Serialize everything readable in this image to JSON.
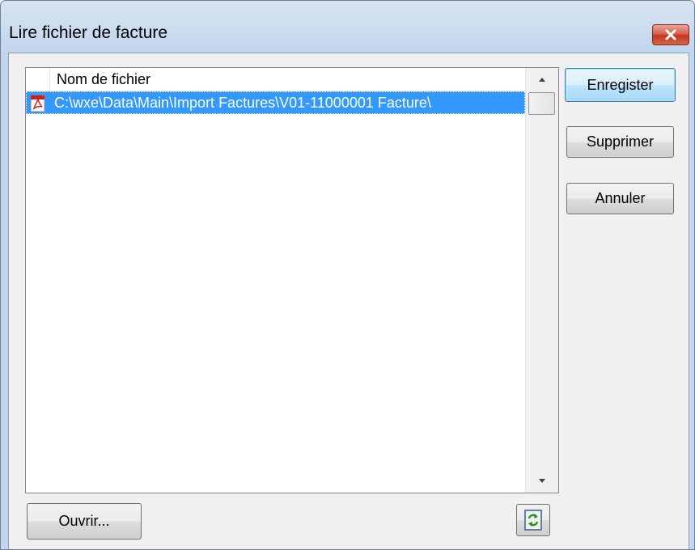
{
  "window": {
    "title": "Lire fichier de facture",
    "close_icon": "close-x-icon"
  },
  "file_list": {
    "column_header": "Nom de fichier",
    "rows": [
      {
        "icon": "pdf-file-icon",
        "path": "C:\\wxe\\Data\\Main\\Import Factures\\V01-11000001 Facture\\",
        "selected": true
      }
    ]
  },
  "buttons": {
    "save": "Enregister",
    "delete": "Supprimer",
    "cancel": "Annuler",
    "open": "Ouvrir...",
    "refresh_icon": "refresh-icon"
  },
  "colors": {
    "selection": "#3399ff",
    "close_button": "#c4381f",
    "titlebar": "#c4d6ec",
    "client_background": "#f0f0f0"
  }
}
